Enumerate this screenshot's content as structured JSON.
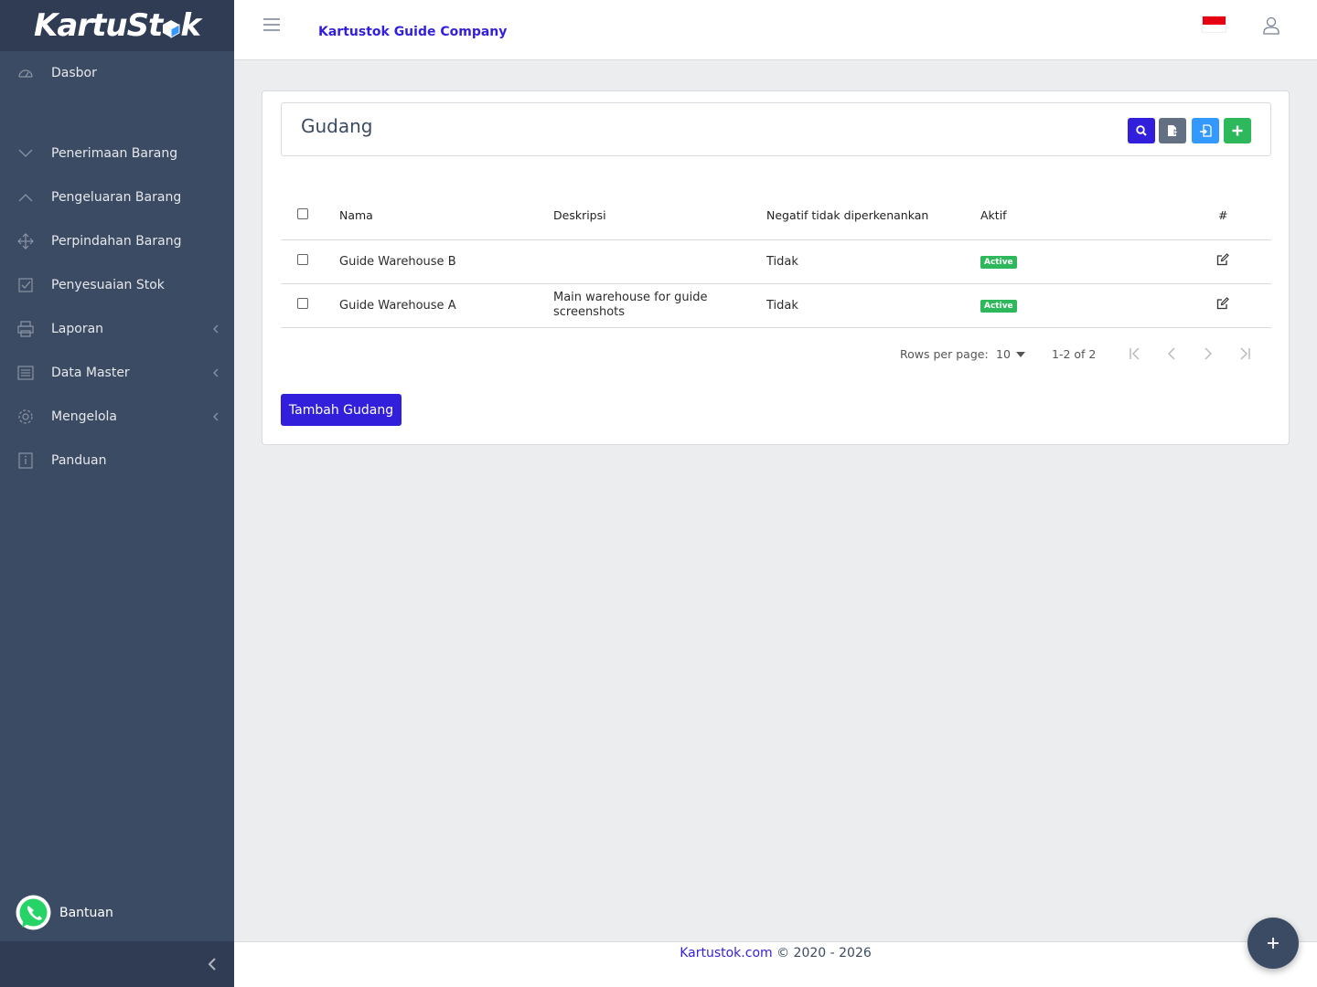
{
  "brand": {
    "name": "KartuStok",
    "name_left": "KartuSt",
    "name_right": "k"
  },
  "sidebar": {
    "items": [
      {
        "label": "Dasbor",
        "icon": "speedometer-icon"
      },
      {
        "label": "Penerimaan Barang",
        "icon": "chevron-down-icon"
      },
      {
        "label": "Pengeluaran Barang",
        "icon": "chevron-up-icon"
      },
      {
        "label": "Perpindahan Barang",
        "icon": "move-icon"
      },
      {
        "label": "Penyesuaian Stok",
        "icon": "task-icon"
      },
      {
        "label": "Laporan",
        "icon": "print-icon",
        "expandable": true
      },
      {
        "label": "Data Master",
        "icon": "list-icon",
        "expandable": true
      },
      {
        "label": "Mengelola",
        "icon": "settings-icon",
        "expandable": true
      },
      {
        "label": "Panduan",
        "icon": "info-icon"
      }
    ],
    "help_label": "Bantuan"
  },
  "header": {
    "company": "Kartustok Guide Company",
    "language": "id"
  },
  "page": {
    "title": "Gudang",
    "table": {
      "columns": [
        "Nama",
        "Deskripsi",
        "Negatif tidak diperkenankan",
        "Aktif",
        "#"
      ],
      "rows": [
        {
          "name": "Guide Warehouse B",
          "description": "",
          "negative": "Tidak",
          "active": "Active"
        },
        {
          "name": "Guide Warehouse A",
          "description": "Main warehouse for guide screenshots",
          "negative": "Tidak",
          "active": "Active"
        }
      ]
    },
    "pagination": {
      "rows_per_page_label": "Rows per page:",
      "rows_per_page": "10",
      "range": "1-2 of 2"
    },
    "add_button": "Tambah Gudang"
  },
  "footer": {
    "link": "Kartustok.com",
    "text": "© 2020 - 2026"
  },
  "colors": {
    "primary": "#321fdb",
    "sidebar": "#3c4b64",
    "success": "#2eb85c",
    "info": "#3399ff",
    "secondary": "#636f83"
  }
}
